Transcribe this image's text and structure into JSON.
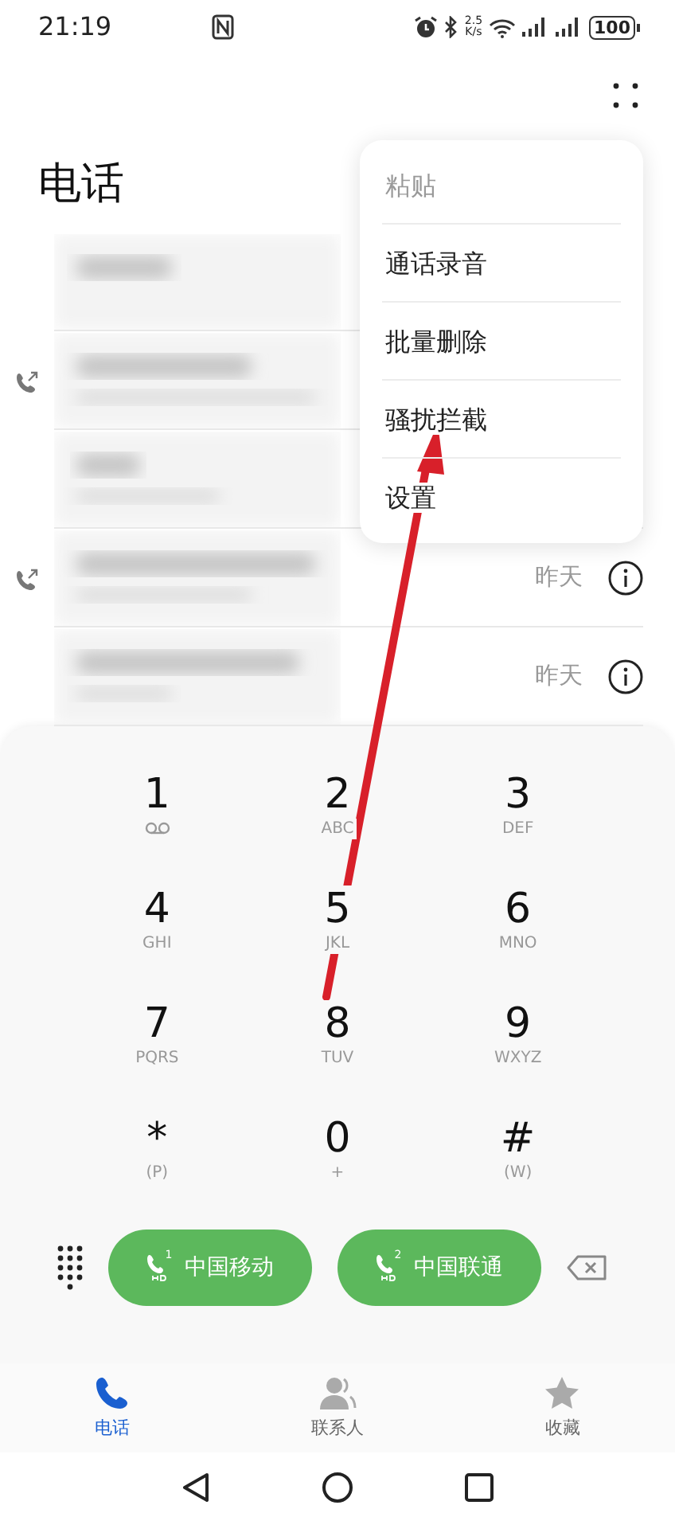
{
  "status_bar": {
    "time": "21:19",
    "speed_value": "2.5",
    "speed_unit": "K/s",
    "battery": "100"
  },
  "header": {
    "title": "电话"
  },
  "menu": {
    "items": [
      {
        "label": "粘贴",
        "disabled": true
      },
      {
        "label": "通话录音",
        "disabled": false
      },
      {
        "label": "批量删除",
        "disabled": false
      },
      {
        "label": "骚扰拦截",
        "disabled": false
      },
      {
        "label": "设置",
        "disabled": false
      }
    ]
  },
  "call_log": [
    {
      "outgoing": false
    },
    {
      "outgoing": true
    },
    {
      "outgoing": false
    },
    {
      "outgoing": true,
      "date": "昨天"
    },
    {
      "outgoing": false,
      "date": "昨天"
    }
  ],
  "keypad": [
    {
      "digit": "1",
      "kind": "voicemail"
    },
    {
      "digit": "2",
      "letters": "ABC",
      "kind": "letters"
    },
    {
      "digit": "3",
      "letters": "DEF",
      "kind": "letters"
    },
    {
      "digit": "4",
      "letters": "GHI",
      "kind": "letters"
    },
    {
      "digit": "5",
      "letters": "JKL",
      "kind": "letters"
    },
    {
      "digit": "6",
      "letters": "MNO",
      "kind": "letters"
    },
    {
      "digit": "7",
      "letters": "PQRS",
      "kind": "letters"
    },
    {
      "digit": "8",
      "letters": "TUV",
      "kind": "letters"
    },
    {
      "digit": "9",
      "letters": "WXYZ",
      "kind": "letters"
    },
    {
      "digit": "*",
      "letters": "(P)",
      "kind": "letters"
    },
    {
      "digit": "0",
      "letters": "+",
      "kind": "letters"
    },
    {
      "digit": "#",
      "letters": "(W)",
      "kind": "letters"
    }
  ],
  "call_buttons": [
    {
      "label": "中国移动",
      "sim": "1"
    },
    {
      "label": "中国联通",
      "sim": "2"
    }
  ],
  "tabs": [
    {
      "label": "电话",
      "selected": true
    },
    {
      "label": "联系人",
      "selected": false
    },
    {
      "label": "收藏",
      "selected": false
    }
  ]
}
